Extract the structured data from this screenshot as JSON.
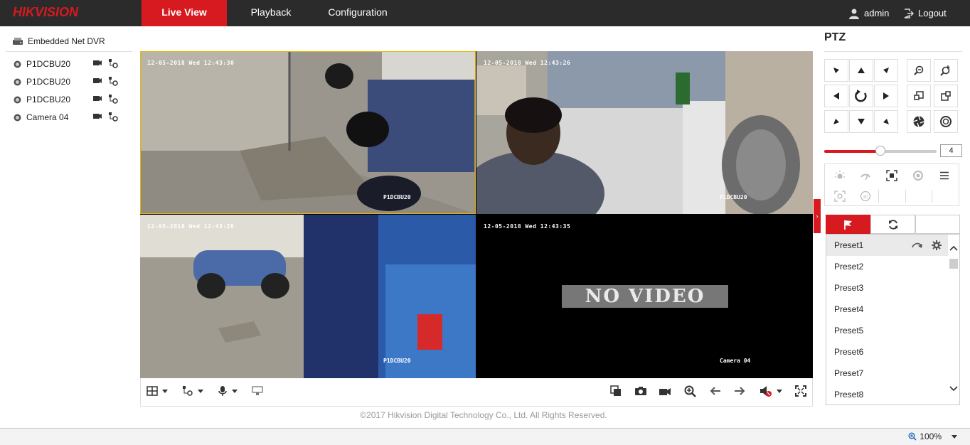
{
  "header": {
    "logo": "HIKVISION",
    "tabs": [
      {
        "label": "Live View",
        "active": true
      },
      {
        "label": "Playback",
        "active": false
      },
      {
        "label": "Configuration",
        "active": false
      }
    ],
    "user": "admin",
    "logout": "Logout"
  },
  "device_tree": {
    "root": "Embedded Net DVR",
    "cameras": [
      {
        "label": "P1DCBU20"
      },
      {
        "label": "P1DCBU20"
      },
      {
        "label": "P1DCBU20"
      },
      {
        "label": "Camera 04"
      }
    ]
  },
  "video": {
    "tiles": [
      {
        "time": "12-05-2018 Wed 12:43:30",
        "name": "P1DCBU20",
        "selected": true
      },
      {
        "time": "12-05-2018 Wed 12:43:26",
        "name": "P1DCBU20",
        "selected": false
      },
      {
        "time": "12-05-2018 Wed 12:43:28",
        "name": "P1DCBU20",
        "selected": false
      },
      {
        "time": "12-05-2018 Wed 12:43:35",
        "name": "Camera 04",
        "selected": false,
        "no_video": "NO VIDEO"
      }
    ]
  },
  "toolbar": {
    "left_icons": [
      "window-layout-icon",
      "stream-type-icon",
      "microphone-icon",
      "unlock-icon"
    ],
    "right_icons": [
      "capture-all-icon",
      "snapshot-icon",
      "record-icon",
      "digital-zoom-icon",
      "previous-page-icon",
      "next-page-icon",
      "audio-mute-icon",
      "fullscreen-icon"
    ]
  },
  "copyright": "©2017 Hikvision Digital Technology Co., Ltd. All Rights Reserved.",
  "status": {
    "zoom": "100%"
  },
  "ptz": {
    "title": "PTZ",
    "speed": "4",
    "speed_fraction": 0.5,
    "presets": [
      {
        "label": "Preset1"
      },
      {
        "label": "Preset2"
      },
      {
        "label": "Preset3"
      },
      {
        "label": "Preset4"
      },
      {
        "label": "Preset5"
      },
      {
        "label": "Preset6"
      },
      {
        "label": "Preset7"
      },
      {
        "label": "Preset8"
      }
    ]
  },
  "colors": {
    "accent": "#d71920",
    "topbar": "#2b2b2b",
    "selected_border": "#e8b500"
  }
}
